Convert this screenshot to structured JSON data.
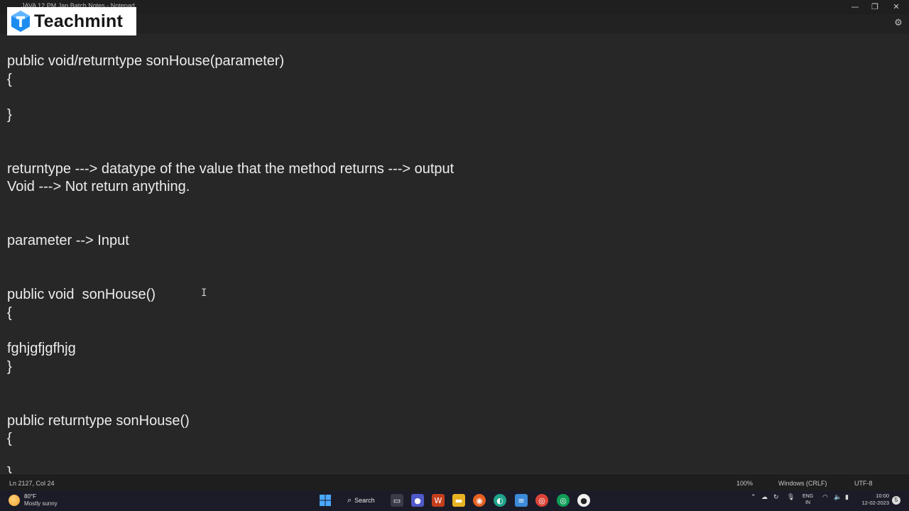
{
  "window": {
    "title": "JAVA 12 PM Jan Batch Notes - Notepad",
    "minimize_symbol": "—",
    "maximize_symbol": "❐",
    "close_symbol": "✕"
  },
  "logo": {
    "text": "Teachmint"
  },
  "editor": {
    "lines": [
      "public void/returntype sonHouse(parameter)",
      "{",
      "}",
      "returntype ---> datatype of the value that the method returns ---> output",
      "Void ---> Not return anything.",
      "parameter --> Input",
      "public void  sonHouse()",
      "{",
      "fghjgfjgfhjg",
      "}",
      "public returntype sonHouse()",
      "{",
      "}"
    ],
    "text_cursor_icon": "I-beam-cursor-icon"
  },
  "statusbar": {
    "position": "Ln 2127, Col 24",
    "zoom": "100%",
    "line_ending": "Windows (CRLF)",
    "encoding": "UTF-8"
  },
  "taskbar": {
    "weather_temp": "80°F",
    "weather_desc": "Mostly sunny",
    "search_label": "Search",
    "lang_line1": "ENG",
    "lang_line2": "IN",
    "time": "10:00",
    "date": "12-02-2023",
    "notification_count": "5"
  },
  "colors": {
    "editor_bg": "#272727",
    "text": "#ececec",
    "taskbar_bg": "#1c1c28"
  }
}
